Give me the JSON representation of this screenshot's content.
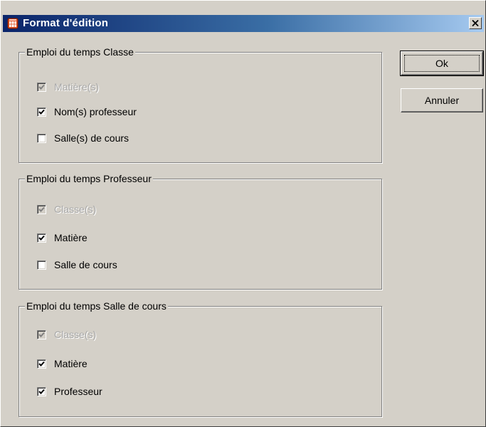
{
  "window": {
    "title": "Format d'édition",
    "close_glyph": "✕"
  },
  "groups": [
    {
      "legend": "Emploi du temps Classe",
      "items": [
        {
          "label": "Matière(s)",
          "checked": true,
          "disabled": true
        },
        {
          "label": "Nom(s) professeur",
          "checked": true,
          "disabled": false
        },
        {
          "label": "Salle(s) de cours",
          "checked": false,
          "disabled": false
        }
      ]
    },
    {
      "legend": "Emploi du temps Professeur",
      "items": [
        {
          "label": "Classe(s)",
          "checked": true,
          "disabled": true
        },
        {
          "label": "Matière",
          "checked": true,
          "disabled": false
        },
        {
          "label": "Salle de cours",
          "checked": false,
          "disabled": false
        }
      ]
    },
    {
      "legend": "Emploi du temps Salle de cours",
      "items": [
        {
          "label": "Classe(s)",
          "checked": true,
          "disabled": true
        },
        {
          "label": "Matière",
          "checked": true,
          "disabled": false
        },
        {
          "label": "Professeur",
          "checked": true,
          "disabled": false
        }
      ]
    }
  ],
  "buttons": {
    "ok": "Ok",
    "cancel": "Annuler"
  },
  "colors": {
    "titlebar_start": "#0a246a",
    "titlebar_end": "#a6caf0",
    "dialog_face": "#d4d0c8",
    "disabled_text": "#a8a8a8"
  },
  "icons": {
    "app": "calendar-app-icon",
    "close": "close-icon",
    "check": "checkmark-icon"
  }
}
